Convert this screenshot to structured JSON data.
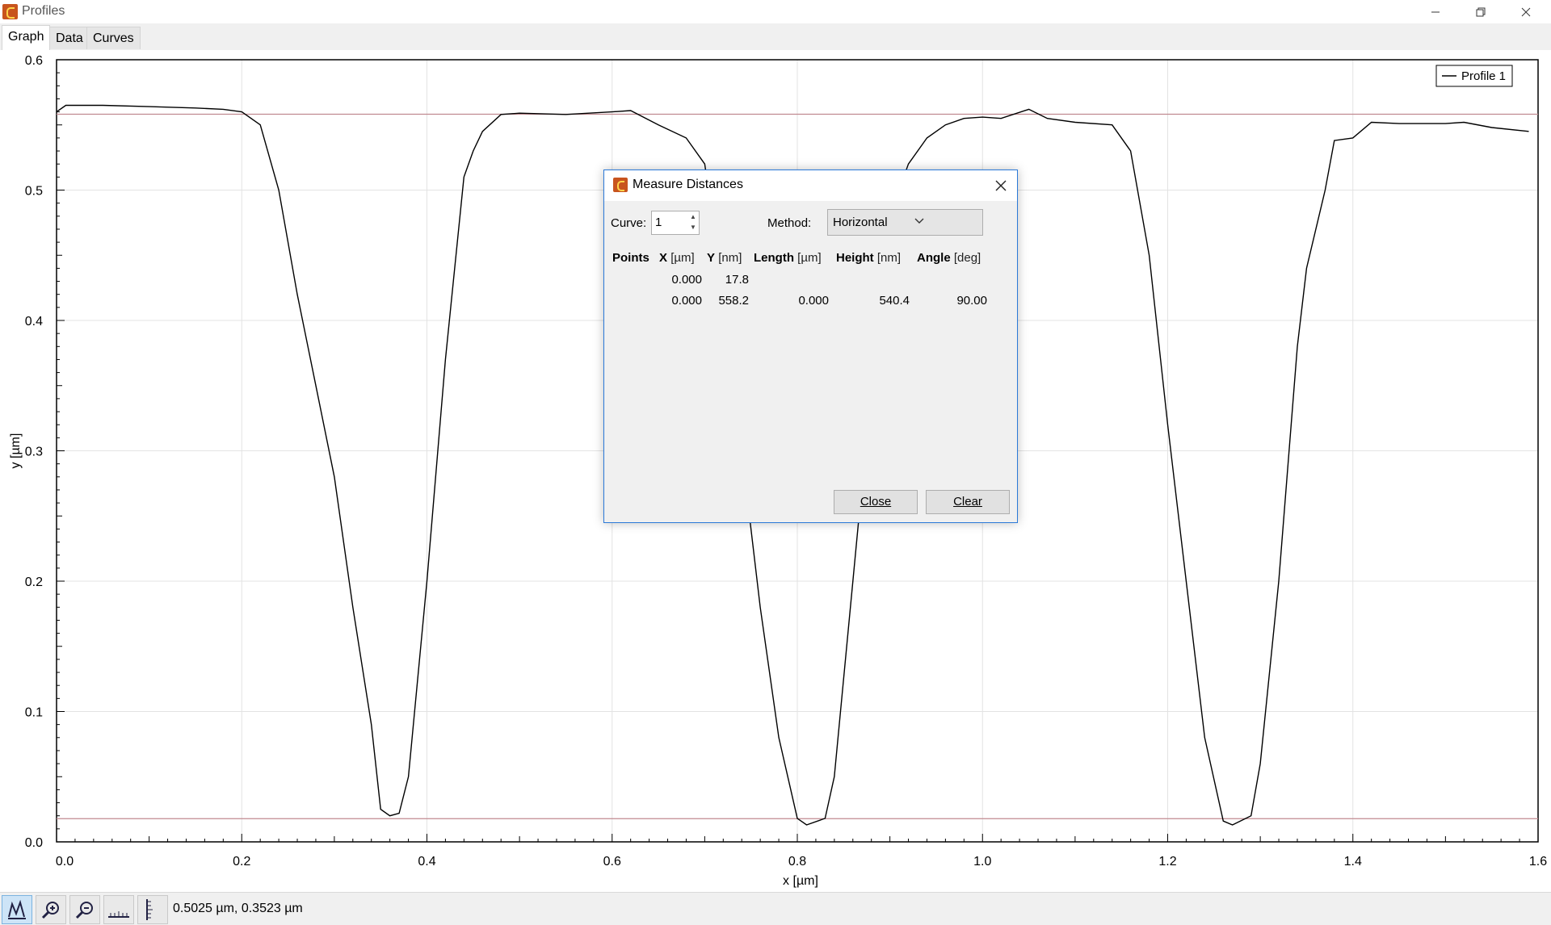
{
  "window": {
    "title": "Profiles"
  },
  "tabs": [
    {
      "label": "Graph"
    },
    {
      "label": "Data"
    },
    {
      "label": "Curves"
    }
  ],
  "status": {
    "coordinates": "0.5025 µm, 0.3523 µm"
  },
  "dialog": {
    "title": "Measure Distances",
    "curve_label": "Curve:",
    "curve_value": "1",
    "method_label": "Method:",
    "method_value": "Horizontal",
    "headers": {
      "points": "Points",
      "x_bold": "X",
      "x_unit": "[µm]",
      "y_bold": "Y",
      "y_unit": "[nm]",
      "length_bold": "Length",
      "length_unit": "[µm]",
      "height_bold": "Height",
      "height_unit": "[nm]",
      "angle_bold": "Angle",
      "angle_unit": "[deg]"
    },
    "rows": [
      {
        "x": "0.000",
        "y": "17.8",
        "length": "",
        "height": "",
        "angle": ""
      },
      {
        "x": "0.000",
        "y": "558.2",
        "length": "0.000",
        "height": "540.4",
        "angle": "90.00"
      }
    ],
    "close_label": "Close",
    "clear_label": "Clear"
  },
  "chart_data": {
    "type": "line",
    "xlabel": "x [µm]",
    "ylabel": "y [µm]",
    "xlim": [
      0,
      1.6
    ],
    "ylim": [
      0,
      0.6
    ],
    "xticks": [
      "0.0",
      "0.2",
      "0.4",
      "0.6",
      "0.8",
      "1.0",
      "1.2",
      "1.4",
      "1.6"
    ],
    "yticks": [
      "0.0",
      "0.1",
      "0.2",
      "0.3",
      "0.4",
      "0.5",
      "0.6"
    ],
    "grid": true,
    "legend": "top-right",
    "series": [
      {
        "name": "Profile 1",
        "color": "#000000",
        "x": [
          0.0,
          0.01,
          0.05,
          0.1,
          0.15,
          0.18,
          0.2,
          0.22,
          0.24,
          0.26,
          0.28,
          0.3,
          0.32,
          0.34,
          0.35,
          0.36,
          0.37,
          0.38,
          0.4,
          0.42,
          0.44,
          0.45,
          0.46,
          0.48,
          0.5,
          0.55,
          0.6,
          0.62,
          0.65,
          0.68,
          0.7,
          0.72,
          0.74,
          0.76,
          0.78,
          0.8,
          0.81,
          0.83,
          0.84,
          0.86,
          0.88,
          0.9,
          0.92,
          0.94,
          0.96,
          0.98,
          1.0,
          1.02,
          1.05,
          1.07,
          1.1,
          1.14,
          1.16,
          1.18,
          1.2,
          1.22,
          1.24,
          1.26,
          1.27,
          1.29,
          1.3,
          1.32,
          1.34,
          1.35,
          1.37,
          1.38,
          1.4,
          1.42,
          1.45,
          1.5,
          1.52,
          1.55,
          1.59
        ],
        "y": [
          0.56,
          0.565,
          0.565,
          0.564,
          0.563,
          0.562,
          0.56,
          0.55,
          0.5,
          0.42,
          0.35,
          0.28,
          0.18,
          0.09,
          0.025,
          0.02,
          0.022,
          0.05,
          0.2,
          0.37,
          0.51,
          0.53,
          0.545,
          0.558,
          0.559,
          0.558,
          0.56,
          0.561,
          0.55,
          0.54,
          0.52,
          0.42,
          0.3,
          0.18,
          0.08,
          0.018,
          0.013,
          0.018,
          0.05,
          0.2,
          0.35,
          0.48,
          0.52,
          0.54,
          0.55,
          0.555,
          0.556,
          0.555,
          0.562,
          0.555,
          0.552,
          0.55,
          0.53,
          0.45,
          0.32,
          0.2,
          0.08,
          0.016,
          0.013,
          0.02,
          0.06,
          0.2,
          0.38,
          0.44,
          0.5,
          0.538,
          0.54,
          0.552,
          0.551,
          0.551,
          0.552,
          0.548,
          0.545
        ]
      }
    ],
    "markers": [
      {
        "y": 0.5582,
        "color": "#c08a90"
      },
      {
        "y": 0.0178,
        "color": "#c08a90"
      }
    ]
  }
}
